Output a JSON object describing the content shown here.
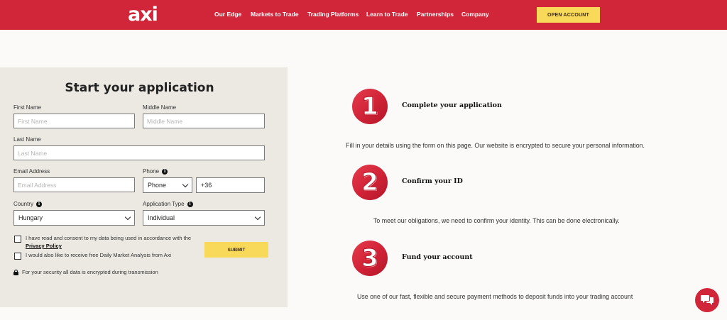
{
  "header": {
    "logo": "axi",
    "nav": [
      {
        "label": "Our Edge"
      },
      {
        "label": "Markets to Trade"
      },
      {
        "label": "Trading Platforms"
      },
      {
        "label": "Learn to Trade"
      },
      {
        "label": "Partnerships"
      },
      {
        "label": "Company"
      }
    ],
    "open_account": "OPEN ACCOUNT"
  },
  "form": {
    "title": "Start your application",
    "first_name": {
      "label": "First Name",
      "placeholder": "First Name"
    },
    "middle_name": {
      "label": "Middle Name",
      "placeholder": "Middle Name"
    },
    "last_name": {
      "label": "Last Name",
      "placeholder": "Last Name"
    },
    "email": {
      "label": "Email Address",
      "placeholder": "Email Address"
    },
    "phone": {
      "label": "Phone",
      "type_value": "Phone",
      "code_value": "+36"
    },
    "country": {
      "label": "Country",
      "value": "Hungary"
    },
    "application_type": {
      "label": "Application Type",
      "value": "Individual"
    },
    "consent_text": "I have read and consent to my data being used in accordance with the",
    "privacy_link": "Privacy Policy",
    "newsletter_text": "I would also like to receive free Daily Market Analysis from Axi",
    "submit": "SUBMIT",
    "security_note": "For your security all data is encrypted during transmission"
  },
  "steps": [
    {
      "number": "1",
      "title": "Complete your application",
      "desc": "Fill in your details using the form on this page. Our website is encrypted to secure your personal information."
    },
    {
      "number": "2",
      "title": "Confirm your ID",
      "desc": "To meet our obligations, we need to confirm your identity. This can be done electronically."
    },
    {
      "number": "3",
      "title": "Fund your account",
      "desc": "Use one of our fast, flexible and secure payment methods to deposit funds into your trading account"
    }
  ],
  "colors": {
    "brand_red": "#d1263a",
    "accent_yellow": "#f9d95a",
    "panel_bg": "#ece9e2"
  },
  "icons": {
    "chat": "chat-bubble-icon",
    "info": "info-icon",
    "lock": "lock-icon",
    "dropdown": "chevron-down-icon"
  }
}
